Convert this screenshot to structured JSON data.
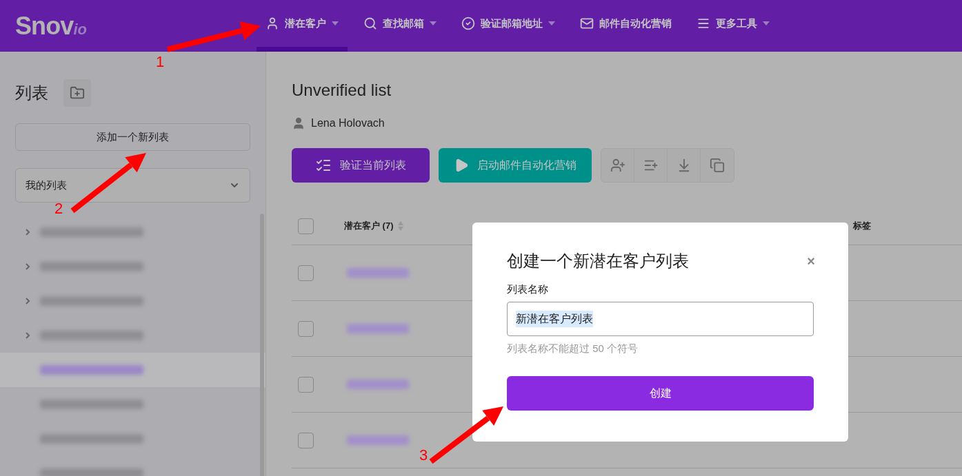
{
  "logo": {
    "main": "Snov",
    "suffix": "io"
  },
  "nav": [
    {
      "label": "潜在客户",
      "dropdown": true,
      "selected": true
    },
    {
      "label": "查找邮箱",
      "dropdown": true,
      "selected": false
    },
    {
      "label": "验证邮箱地址",
      "dropdown": true,
      "selected": false
    },
    {
      "label": "邮件自动化营销",
      "dropdown": false,
      "selected": false
    },
    {
      "label": "更多工具",
      "dropdown": true,
      "selected": false
    }
  ],
  "sidebar": {
    "title": "列表",
    "add_button": "添加一个新列表",
    "filter": "我的列表",
    "items": [
      {
        "expandable": true,
        "selected": false
      },
      {
        "expandable": true,
        "selected": false
      },
      {
        "expandable": true,
        "selected": false
      },
      {
        "expandable": true,
        "selected": false
      },
      {
        "expandable": false,
        "selected": true
      },
      {
        "expandable": false,
        "selected": false
      },
      {
        "expandable": false,
        "selected": false
      },
      {
        "expandable": false,
        "selected": false
      }
    ]
  },
  "main": {
    "title": "Unverified list",
    "owner": "Lena Holovach",
    "verify_button": "验证当前列表",
    "campaign_button": "启动邮件自动化营销",
    "table": {
      "select_all_checked": false,
      "columns": [
        "潜在客户 (7)",
        "标签"
      ],
      "rows": [
        {
          "checked": false
        },
        {
          "checked": false
        },
        {
          "checked": false
        },
        {
          "checked": false
        }
      ]
    }
  },
  "dialog": {
    "title": "创建一个新潜在客户列表",
    "close": "×",
    "field_label": "列表名称",
    "value": "新潜在客户列表",
    "hint": "列表名称不能超过 50 个符号",
    "submit": "创建"
  },
  "annotations": [
    {
      "number": "1"
    },
    {
      "number": "2"
    },
    {
      "number": "3"
    }
  ]
}
